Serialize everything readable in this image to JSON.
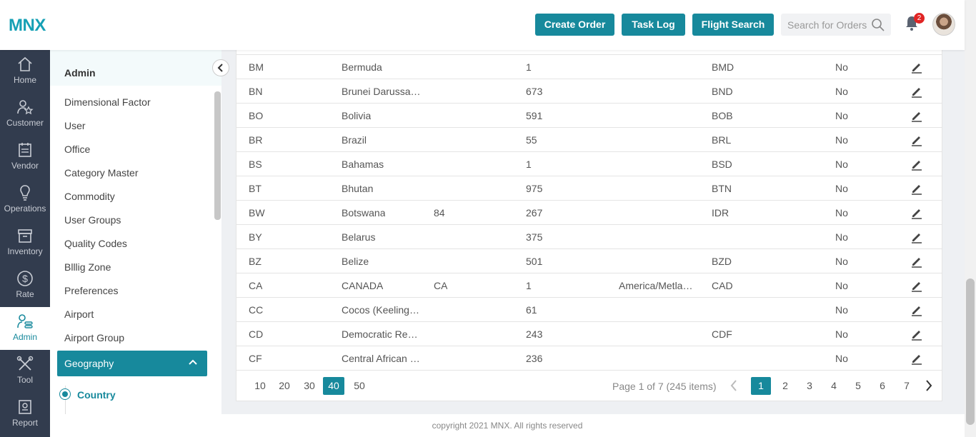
{
  "header": {
    "logo": "MNX",
    "buttons": {
      "create_order": "Create Order",
      "task_log": "Task Log",
      "flight_search": "Flight Search"
    },
    "search_placeholder": "Search for Orders",
    "notification_count": "2"
  },
  "leftnav": [
    {
      "label": "Home",
      "icon": "home-icon"
    },
    {
      "label": "Customer",
      "icon": "customer-icon"
    },
    {
      "label": "Vendor",
      "icon": "vendor-icon"
    },
    {
      "label": "Operations",
      "icon": "lightbulb-icon"
    },
    {
      "label": "Inventory",
      "icon": "inventory-icon"
    },
    {
      "label": "Rate",
      "icon": "dollar-icon"
    },
    {
      "label": "Admin",
      "icon": "admin-icon",
      "active": true
    },
    {
      "label": "Tool",
      "icon": "tools-icon"
    },
    {
      "label": "Report",
      "icon": "report-icon"
    }
  ],
  "submenu": {
    "title": "Admin",
    "items": [
      "Dimensional Factor",
      "User",
      "Office",
      "Category Master",
      "Commodity",
      "User Groups",
      "Quality Codes",
      "Blllig Zone",
      "Preferences",
      "Airport",
      "Airport Group"
    ],
    "group": "Geography",
    "active_child": "Country"
  },
  "table": {
    "rows": [
      [
        "BM",
        "Bermuda",
        "",
        "1",
        "",
        "BMD",
        "No"
      ],
      [
        "BN",
        "Brunei Darussa…",
        "",
        "673",
        "",
        "BND",
        "No"
      ],
      [
        "BO",
        "Bolivia",
        "",
        "591",
        "",
        "BOB",
        "No"
      ],
      [
        "BR",
        "Brazil",
        "",
        "55",
        "",
        "BRL",
        "No"
      ],
      [
        "BS",
        "Bahamas",
        "",
        "1",
        "",
        "BSD",
        "No"
      ],
      [
        "BT",
        "Bhutan",
        "",
        "975",
        "",
        "BTN",
        "No"
      ],
      [
        "BW",
        "Botswana",
        "84",
        "267",
        "",
        "IDR",
        "No"
      ],
      [
        "BY",
        "Belarus",
        "",
        "375",
        "",
        "",
        "No"
      ],
      [
        "BZ",
        "Belize",
        "",
        "501",
        "",
        "BZD",
        "No"
      ],
      [
        "CA",
        "CANADA",
        "CA",
        "1",
        "America/Metla…",
        "CAD",
        "No"
      ],
      [
        "CC",
        "Cocos (Keeling…",
        "",
        "61",
        "",
        "",
        "No"
      ],
      [
        "CD",
        "Democratic Re…",
        "",
        "243",
        "",
        "CDF",
        "No"
      ],
      [
        "CF",
        "Central African …",
        "",
        "236",
        "",
        "",
        "No"
      ]
    ]
  },
  "pager": {
    "sizes": [
      "10",
      "20",
      "30",
      "40",
      "50"
    ],
    "active_size": "40",
    "info": "Page 1 of 7 (245 items)",
    "pages": [
      "1",
      "2",
      "3",
      "4",
      "5",
      "6",
      "7"
    ],
    "active_page": "1"
  },
  "footer": "copyright 2021 MNX. All rights reserved",
  "colors": {
    "accent": "#17899c",
    "sidebar": "#323c4e",
    "badge": "#e02424"
  }
}
